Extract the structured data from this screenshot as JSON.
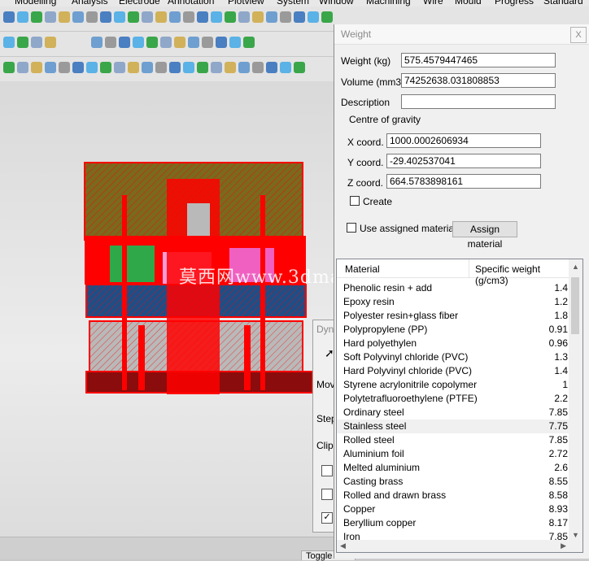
{
  "menubar": {
    "items": [
      "Modelling",
      "Analysis",
      "Electrode",
      "Annotation",
      "Plotview",
      "System",
      "Window",
      "Machining",
      "Wire",
      "Mould",
      "Progress",
      "Standard"
    ]
  },
  "toolbar_icons": [
    "box-icon",
    "cylinder-icon",
    "cube-icon",
    "measure-icon",
    "solid-icon",
    "shape-icon"
  ],
  "colors": {
    "mould_red": "#ff0000",
    "mould_olive": "#7a6a1e",
    "mould_blue": "#1f4e86",
    "mould_green": "#2fa84a",
    "mould_pink": "#f39cd8",
    "mould_grey": "#b9b9b9"
  },
  "watermark": "莫西网www.3dmax.com",
  "dynamic_dialog": {
    "title": "Dyna",
    "labels": [
      "Mov",
      "Step",
      "Clip"
    ],
    "checkboxes": [
      false,
      false,
      true
    ]
  },
  "weight_dialog": {
    "title": "Weight",
    "close_label": "X",
    "weight_label": "Weight (kg)",
    "weight_value": "575.4579447465",
    "volume_label": "Volume (mm3)",
    "volume_value": "74252638.031808853",
    "description_label": "Description",
    "description_value": "",
    "cog_label": "Centre of gravity",
    "x_label": "X coord.",
    "x_value": "1000.0002606934",
    "y_label": "Y coord.",
    "y_value": "-29.402537041",
    "z_label": "Z coord.",
    "z_value": "664.5783898161",
    "create_label": "Create",
    "create_checked": false,
    "use_assigned_label": "Use assigned material",
    "use_assigned_checked": false,
    "assign_button": "Assign material",
    "table": {
      "col_material": "Material",
      "col_weight": "Specific weight (g/cm3)",
      "selected_index": 10,
      "rows": [
        {
          "name": "Phenolic resin + add",
          "value": "1.4"
        },
        {
          "name": "Epoxy resin",
          "value": "1.2"
        },
        {
          "name": "Polyester resin+glass fiber",
          "value": "1.8"
        },
        {
          "name": "Polypropylene (PP)",
          "value": "0.91"
        },
        {
          "name": "Hard polyethylen",
          "value": "0.96"
        },
        {
          "name": "Soft Polyvinyl chloride (PVC)",
          "value": "1.3"
        },
        {
          "name": "Hard Polyvinyl chloride (PVC)",
          "value": "1.4"
        },
        {
          "name": "Styrene acrylonitrile copolymer",
          "value": "1"
        },
        {
          "name": "Polytetrafluoroethylene (PTFE)",
          "value": "2.2"
        },
        {
          "name": "Ordinary steel",
          "value": "7.85"
        },
        {
          "name": "Stainless steel",
          "value": "7.75"
        },
        {
          "name": "Rolled steel",
          "value": "7.85"
        },
        {
          "name": "Aluminium foil",
          "value": "2.72"
        },
        {
          "name": "Melted aluminium",
          "value": "2.6"
        },
        {
          "name": "Casting brass",
          "value": "8.55"
        },
        {
          "name": "Rolled and drawn brass",
          "value": "8.58"
        },
        {
          "name": "Copper",
          "value": "8.93"
        },
        {
          "name": "Beryllium copper",
          "value": "8.17"
        },
        {
          "name": "Iron",
          "value": "7.85"
        }
      ]
    }
  },
  "statusbar": {
    "tab_label": "Toggle"
  }
}
